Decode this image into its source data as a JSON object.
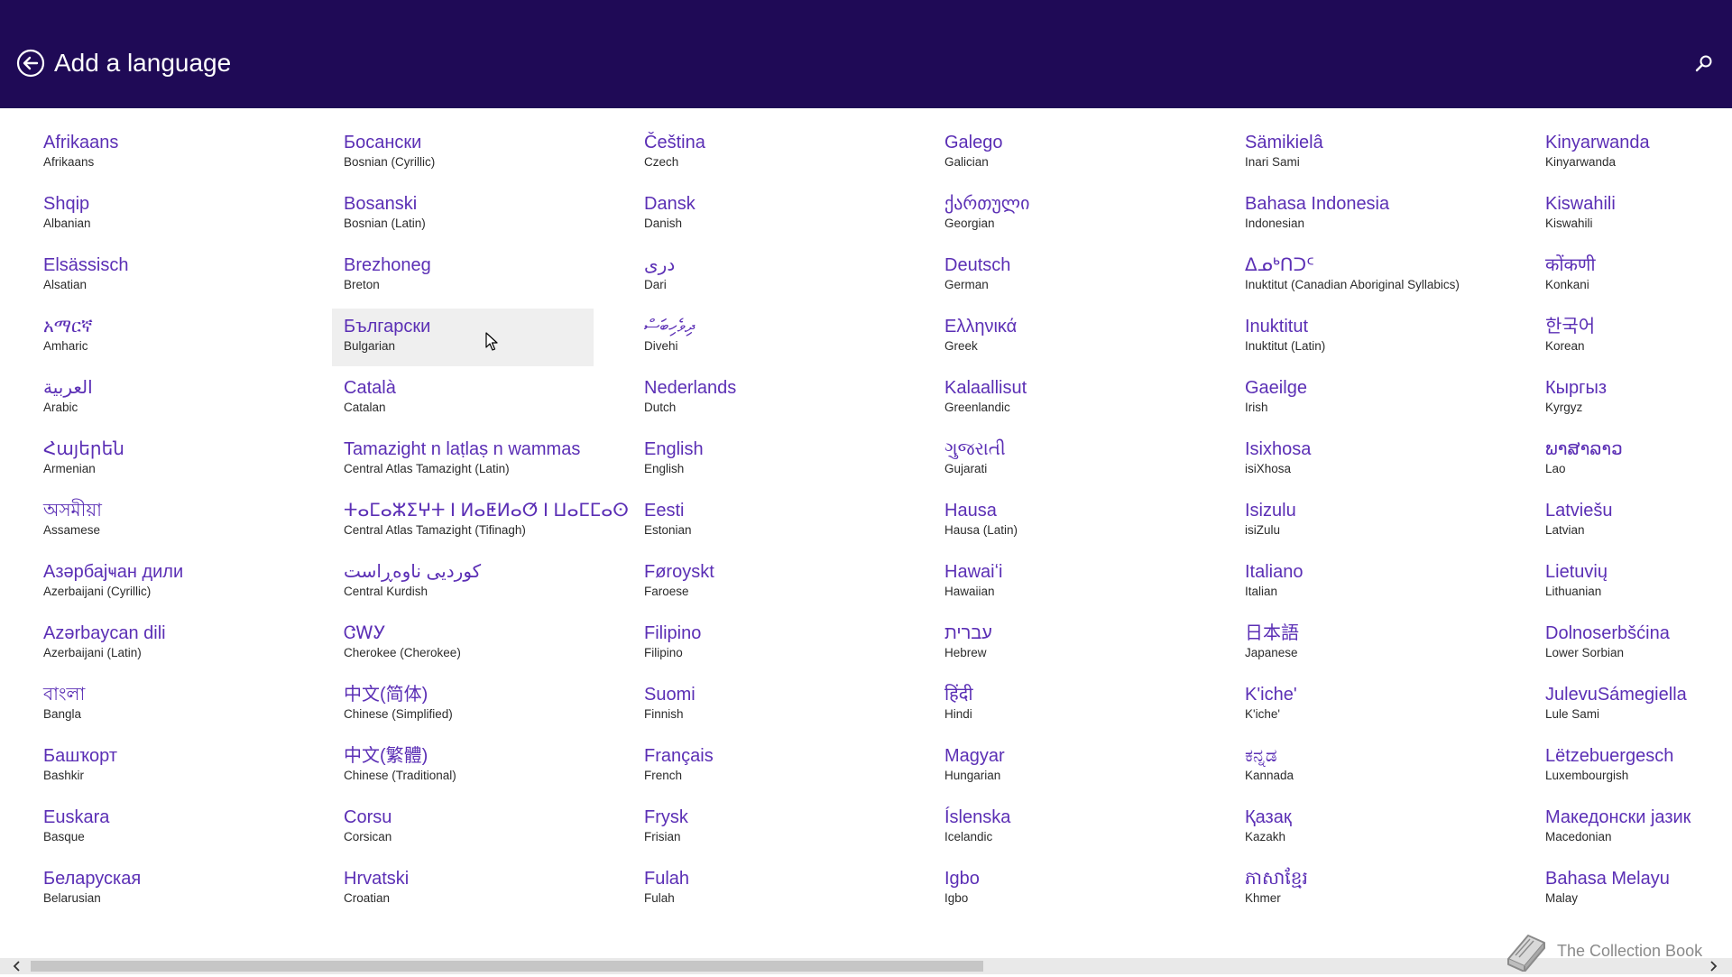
{
  "header": {
    "title": "Add a language",
    "back_icon": "back-arrow-circle-icon",
    "search_icon": "search-icon",
    "background": "#1f0a56"
  },
  "accent_color": "#5b2fb5",
  "hovered_language": "Bulgarian",
  "languages": [
    {
      "native": "Afrikaans",
      "english": "Afrikaans"
    },
    {
      "native": "Shqip",
      "english": "Albanian"
    },
    {
      "native": "Elsässisch",
      "english": "Alsatian"
    },
    {
      "native": "አማርኛ",
      "english": "Amharic"
    },
    {
      "native": "العربية",
      "english": "Arabic"
    },
    {
      "native": "Հայերեն",
      "english": "Armenian"
    },
    {
      "native": "অসমীয়া",
      "english": "Assamese"
    },
    {
      "native": "Азәрбајҹан дили",
      "english": "Azerbaijani (Cyrillic)"
    },
    {
      "native": "Azərbaycan dili",
      "english": "Azerbaijani (Latin)"
    },
    {
      "native": "বাংলা",
      "english": "Bangla"
    },
    {
      "native": "Башҡорт",
      "english": "Bashkir"
    },
    {
      "native": "Euskara",
      "english": "Basque"
    },
    {
      "native": "Беларуская",
      "english": "Belarusian"
    },
    {
      "native": "Босански",
      "english": "Bosnian (Cyrillic)"
    },
    {
      "native": "Bosanski",
      "english": "Bosnian (Latin)"
    },
    {
      "native": "Brezhoneg",
      "english": "Breton"
    },
    {
      "native": "Български",
      "english": "Bulgarian"
    },
    {
      "native": "Català",
      "english": "Catalan"
    },
    {
      "native": "Tamazight n laṭlaṣ n wammas",
      "english": "Central Atlas Tamazight (Latin)"
    },
    {
      "native": "ⵜⴰⵎⴰⵣⵉⵖⵜ ⵏ ⵍⴰⵟⵍⴰⵚ ⵏ ⵡⴰⵎⵎⴰⵙ",
      "english": "Central Atlas Tamazight (Tifinagh)"
    },
    {
      "native": "کوردیی ناوەڕاست",
      "english": "Central Kurdish"
    },
    {
      "native": "ᏣᎳᎩ",
      "english": "Cherokee (Cherokee)"
    },
    {
      "native": "中文(简体)",
      "english": "Chinese (Simplified)"
    },
    {
      "native": "中文(繁體)",
      "english": "Chinese (Traditional)"
    },
    {
      "native": "Corsu",
      "english": "Corsican"
    },
    {
      "native": "Hrvatski",
      "english": "Croatian"
    },
    {
      "native": "Čeština",
      "english": "Czech"
    },
    {
      "native": "Dansk",
      "english": "Danish"
    },
    {
      "native": "درى",
      "english": "Dari"
    },
    {
      "native": "ދިވެހިބަސް",
      "english": "Divehi"
    },
    {
      "native": "Nederlands",
      "english": "Dutch"
    },
    {
      "native": "English",
      "english": "English"
    },
    {
      "native": "Eesti",
      "english": "Estonian"
    },
    {
      "native": "Føroyskt",
      "english": "Faroese"
    },
    {
      "native": "Filipino",
      "english": "Filipino"
    },
    {
      "native": "Suomi",
      "english": "Finnish"
    },
    {
      "native": "Français",
      "english": "French"
    },
    {
      "native": "Frysk",
      "english": "Frisian"
    },
    {
      "native": "Fulah",
      "english": "Fulah"
    },
    {
      "native": "Galego",
      "english": "Galician"
    },
    {
      "native": "ქართული",
      "english": "Georgian"
    },
    {
      "native": "Deutsch",
      "english": "German"
    },
    {
      "native": "Ελληνικά",
      "english": "Greek"
    },
    {
      "native": "Kalaallisut",
      "english": "Greenlandic"
    },
    {
      "native": "ગુજરાતી",
      "english": "Gujarati"
    },
    {
      "native": "Hausa",
      "english": "Hausa (Latin)"
    },
    {
      "native": "Hawaiʻi",
      "english": "Hawaiian"
    },
    {
      "native": "עברית",
      "english": "Hebrew"
    },
    {
      "native": "हिंदी",
      "english": "Hindi"
    },
    {
      "native": "Magyar",
      "english": "Hungarian"
    },
    {
      "native": "Íslenska",
      "english": "Icelandic"
    },
    {
      "native": "Igbo",
      "english": "Igbo"
    },
    {
      "native": "Sämikielâ",
      "english": "Inari Sami"
    },
    {
      "native": "Bahasa Indonesia",
      "english": "Indonesian"
    },
    {
      "native": "ᐃᓄᒃᑎᑐᑦ",
      "english": "Inuktitut (Canadian Aboriginal Syllabics)"
    },
    {
      "native": "Inuktitut",
      "english": "Inuktitut (Latin)"
    },
    {
      "native": "Gaeilge",
      "english": "Irish"
    },
    {
      "native": "Isixhosa",
      "english": "isiXhosa"
    },
    {
      "native": "Isizulu",
      "english": "isiZulu"
    },
    {
      "native": "Italiano",
      "english": "Italian"
    },
    {
      "native": "日本語",
      "english": "Japanese"
    },
    {
      "native": "K'iche'",
      "english": "K'iche'"
    },
    {
      "native": "ಕನ್ನಡ",
      "english": "Kannada"
    },
    {
      "native": "Қазақ",
      "english": "Kazakh"
    },
    {
      "native": "ភាសាខ្មែរ",
      "english": "Khmer"
    },
    {
      "native": "Kinyarwanda",
      "english": "Kinyarwanda"
    },
    {
      "native": "Kiswahili",
      "english": "Kiswahili"
    },
    {
      "native": "कोंकणी",
      "english": "Konkani"
    },
    {
      "native": "한국어",
      "english": "Korean"
    },
    {
      "native": "Кыргыз",
      "english": "Kyrgyz"
    },
    {
      "native": "ພາສາລາວ",
      "english": "Lao"
    },
    {
      "native": "Latviešu",
      "english": "Latvian"
    },
    {
      "native": "Lietuvių",
      "english": "Lithuanian"
    },
    {
      "native": "Dolnoserbšćina",
      "english": "Lower Sorbian"
    },
    {
      "native": "JulevuSámegiella",
      "english": "Lule Sami"
    },
    {
      "native": "Lëtzebuergesch",
      "english": "Luxembourgish"
    },
    {
      "native": "Македонски јазик",
      "english": "Macedonian"
    },
    {
      "native": "Bahasa Melayu",
      "english": "Malay"
    }
  ],
  "scrollbar": {
    "left_icon": "chevron-left-icon",
    "right_icon": "chevron-right-icon",
    "position_fraction": 0.0,
    "visible_fraction": 0.57
  },
  "watermark": {
    "icon": "book-icon",
    "text": "The Collection Book"
  }
}
